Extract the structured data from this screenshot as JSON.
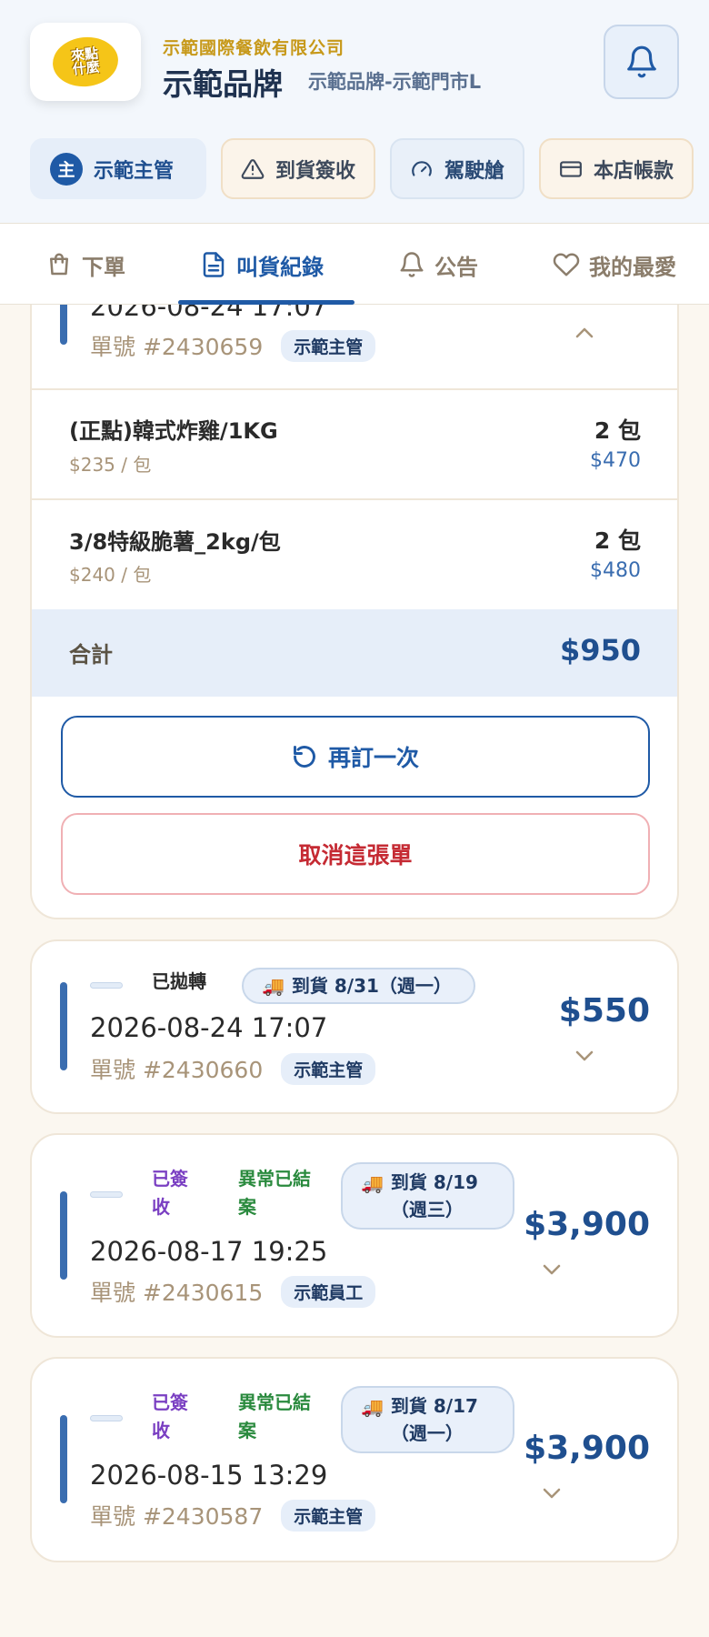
{
  "header": {
    "logo_text": "來點什麼",
    "company": "示範國際餐飲有限公司",
    "brand": "示範品牌",
    "store": "示範品牌-示範門市L"
  },
  "chips": [
    {
      "avatar": "主",
      "label": "示範主管",
      "icon": "avatar"
    },
    {
      "label": "到貨簽收",
      "icon": "warning-icon"
    },
    {
      "label": "駕駛艙",
      "icon": "gauge-icon"
    },
    {
      "label": "本店帳款",
      "icon": "card-icon"
    }
  ],
  "nav": [
    {
      "label": "下單",
      "icon": "bag-icon"
    },
    {
      "label": "叫貨紀錄",
      "icon": "document-icon",
      "active": true
    },
    {
      "label": "公告",
      "icon": "bell-icon"
    },
    {
      "label": "我的最愛",
      "icon": "heart-icon"
    }
  ],
  "expanded_order": {
    "datetime": "2026-08-24 17:07",
    "order_no": "單號 #2430659",
    "tag": "示範主管",
    "items": [
      {
        "name": "(正點)韓式炸雞/1KG",
        "unit_price": "$235 / 包",
        "qty": "2 包",
        "subtotal": "$470"
      },
      {
        "name": "3/8特級脆薯_2kg/包",
        "unit_price": "$240 / 包",
        "qty": "2 包",
        "subtotal": "$480"
      }
    ],
    "total_label": "合計",
    "total": "$950",
    "reorder_label": "再訂一次",
    "cancel_label": "取消這張單"
  },
  "orders": [
    {
      "status": [
        "已拋轉"
      ],
      "status_colors": [
        "#1f5aa6"
      ],
      "delivery": "到貨 8/31（週一）",
      "datetime": "2026-08-24 17:07",
      "order_no": "單號 #2430660",
      "tag": "示範主管",
      "amount": "$550"
    },
    {
      "status": [
        "已簽收",
        "異常已結案"
      ],
      "status_colors": [
        "#7a3fc2",
        "#2a8a3e"
      ],
      "delivery": "到貨 8/19（週三）",
      "datetime": "2026-08-17 19:25",
      "order_no": "單號 #2430615",
      "tag": "示範員工",
      "amount": "$3,900"
    },
    {
      "status": [
        "已簽收",
        "異常已結案"
      ],
      "status_colors": [
        "#7a3fc2",
        "#2a8a3e"
      ],
      "delivery": "到貨 8/17（週一）",
      "datetime": "2026-08-15 13:29",
      "order_no": "單號 #2430587",
      "tag": "示範主管",
      "amount": "$3,900"
    }
  ],
  "colors": {
    "accent": "#1f5aa6",
    "brand_gold": "#c7991a",
    "cancel": "#c52a33",
    "background": "#fbf7f0"
  }
}
